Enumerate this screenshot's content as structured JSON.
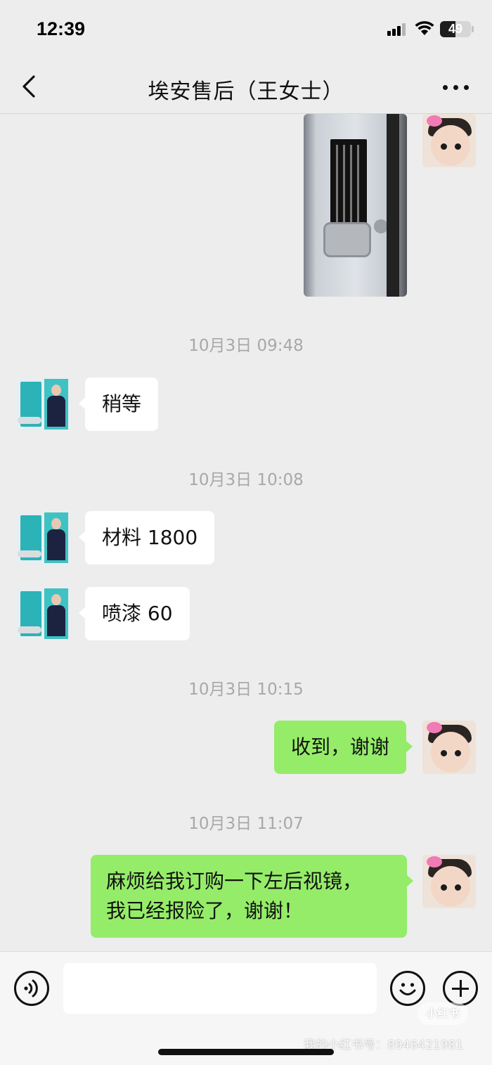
{
  "status_bar": {
    "time": "12:39",
    "battery": "49"
  },
  "header": {
    "title": "埃安售后（王女士）"
  },
  "messages": {
    "ts1": "10月3日 09:48",
    "m1": "稍等",
    "ts2": "10月3日 10:08",
    "m2": "材料 1800",
    "m3": "喷漆 60",
    "ts3": "10月3日 10:15",
    "m4": "收到，谢谢",
    "ts4": "10月3日 11:07",
    "m5_line1": "麻烦给我订购一下左后视镜，",
    "m5_line2": "我已经报险了，谢谢！"
  },
  "input_bar": {
    "value": ""
  },
  "watermark": {
    "logo": "小红书",
    "text": "我的小红书号：8946421981"
  },
  "colors": {
    "outgoing_bubble": "#95ec69",
    "incoming_bubble": "#ffffff",
    "background": "#ededed"
  },
  "icons": [
    "back-chevron-icon",
    "more-icon",
    "voice-icon",
    "emoji-icon",
    "plus-icon",
    "signal-icon",
    "wifi-icon",
    "battery-icon"
  ]
}
